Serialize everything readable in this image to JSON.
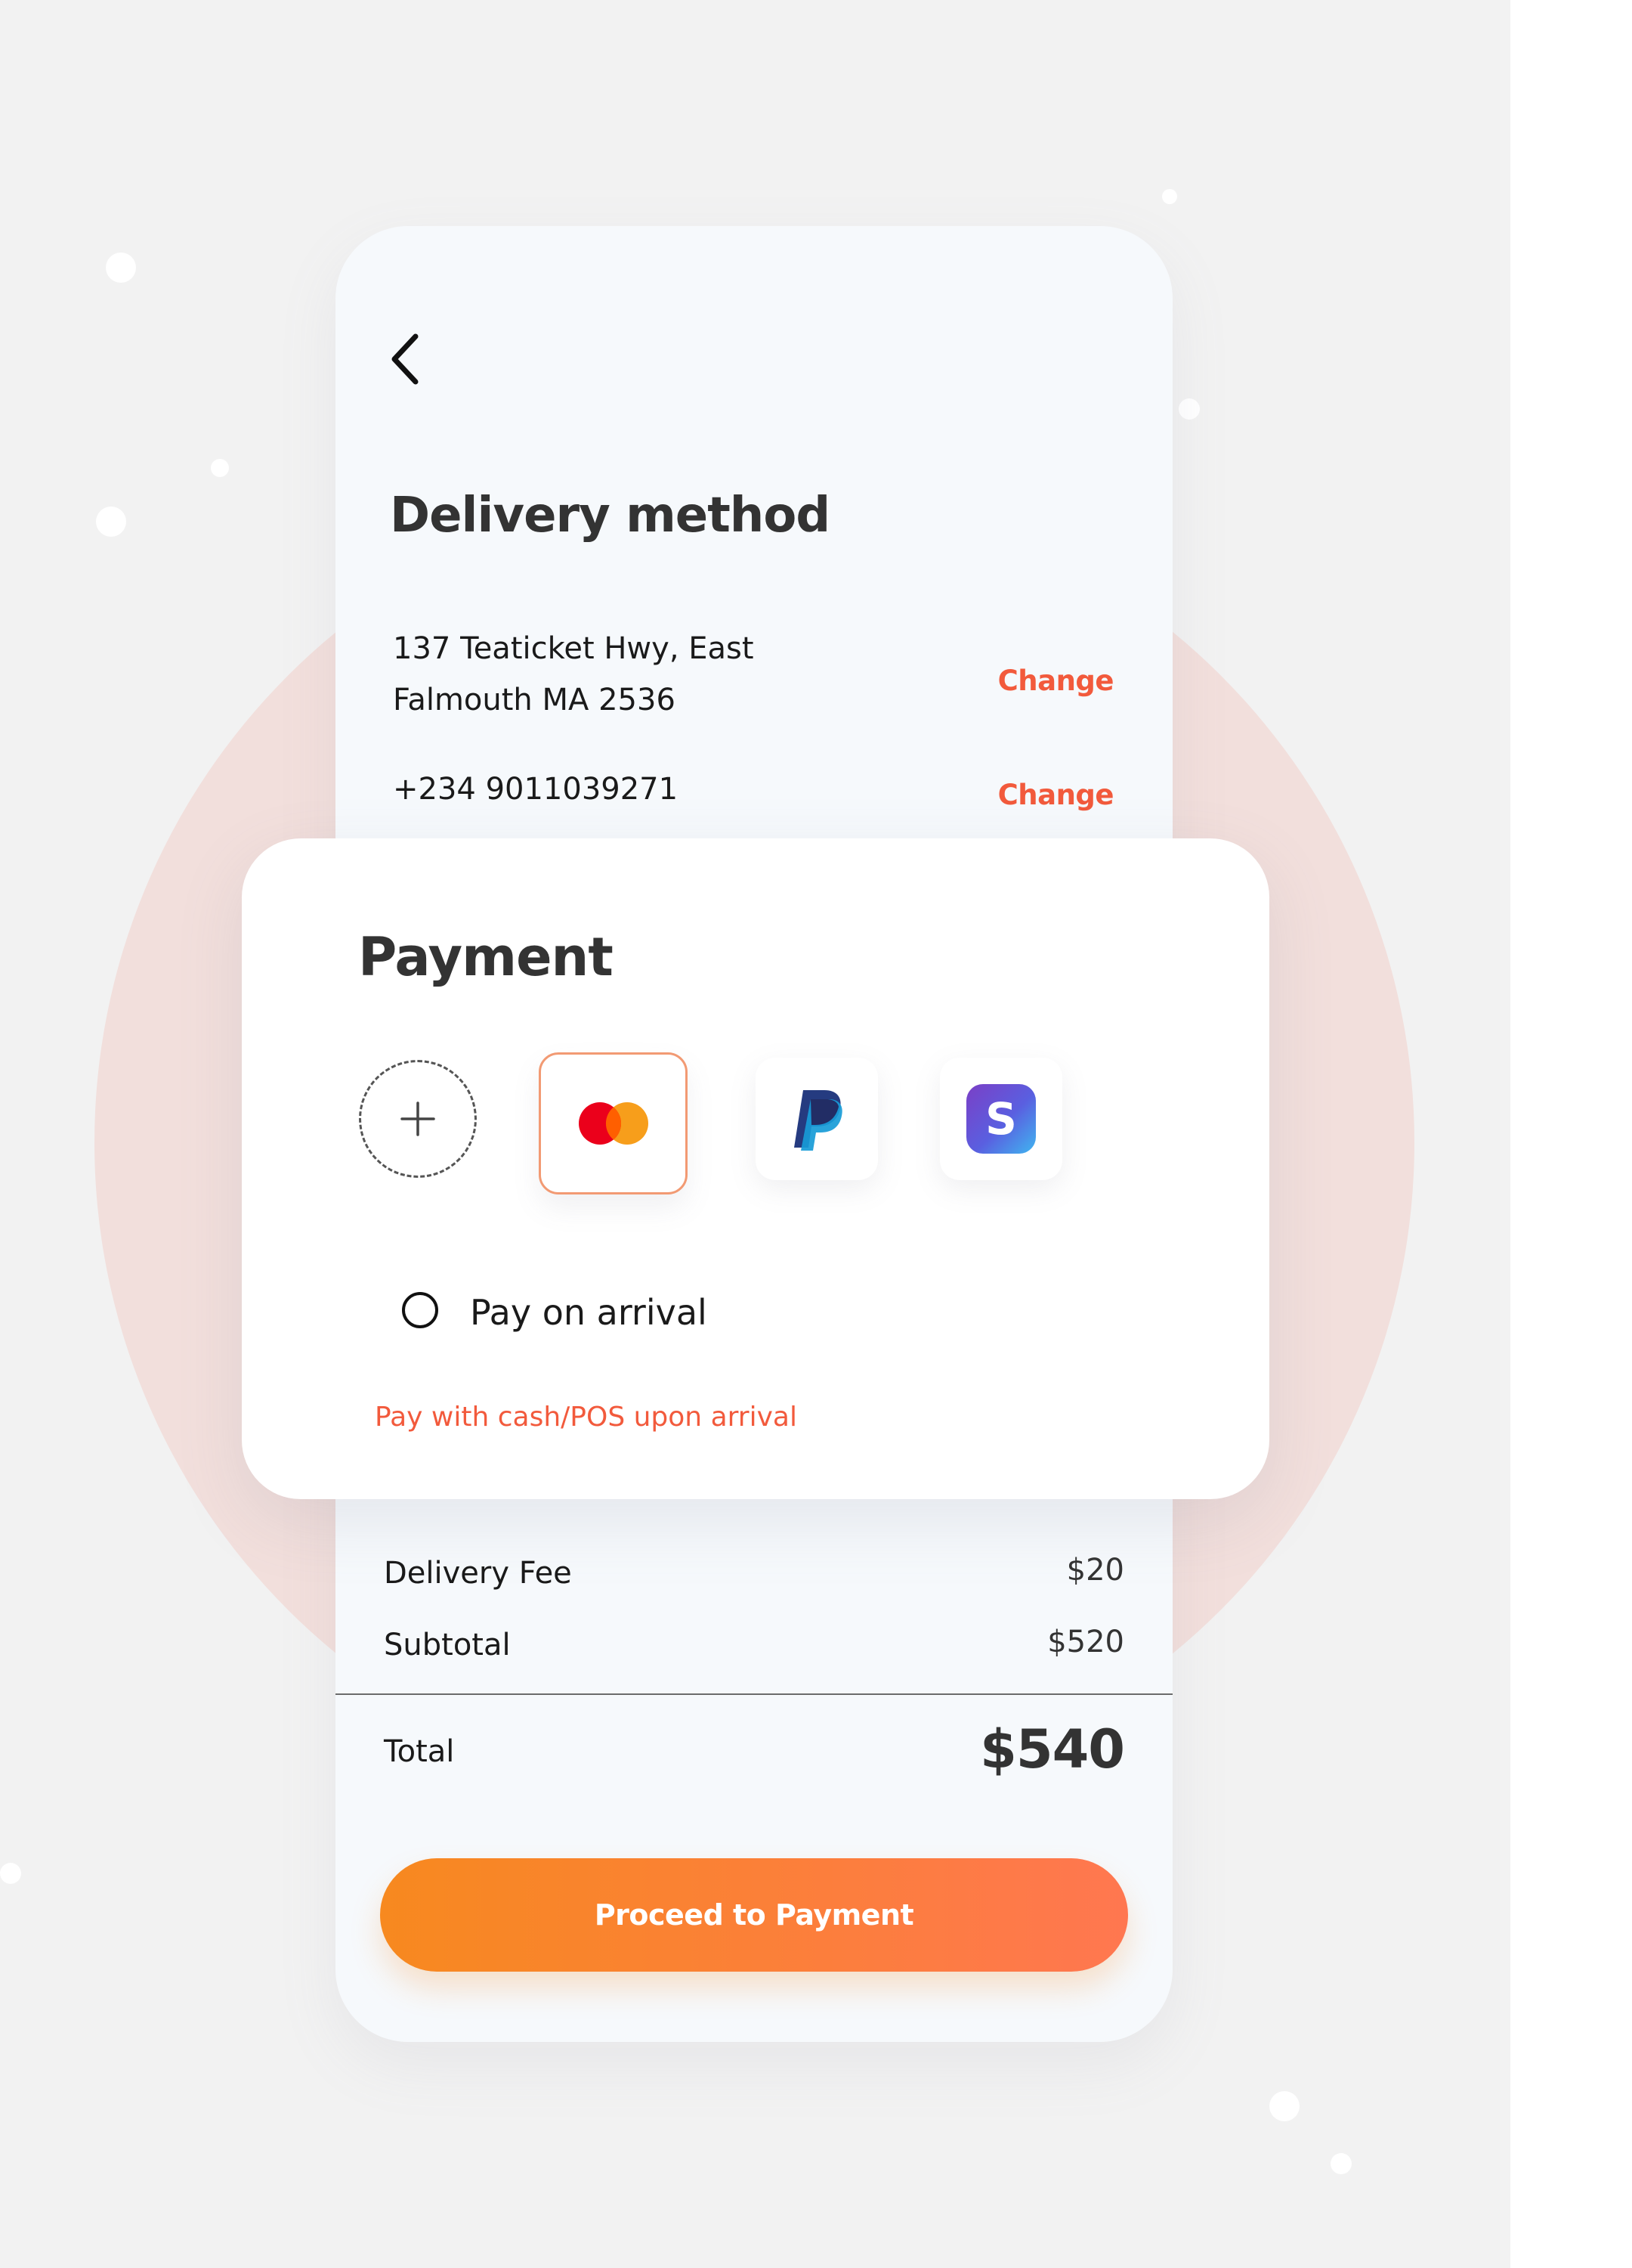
{
  "delivery": {
    "title": "Delivery method",
    "address_line_1": "137 Teaticket Hwy, East",
    "address_line_2": "Falmouth MA 2536",
    "address_change_label": "Change",
    "phone": "+234 9011039271",
    "phone_change_label": "Change"
  },
  "payment": {
    "title": "Payment",
    "methods": [
      {
        "icon": "plus-icon",
        "selected": false
      },
      {
        "icon": "mastercard-icon",
        "selected": true
      },
      {
        "icon": "paypal-icon",
        "selected": false
      },
      {
        "icon": "skrill-icon",
        "selected": false
      }
    ],
    "pay_on_arrival_label": "Pay on arrival",
    "pay_on_arrival_selected": false,
    "note": "Pay with cash/POS upon arrival"
  },
  "summary": {
    "delivery_fee_label": "Delivery Fee",
    "delivery_fee_value": "$20",
    "subtotal_label": "Subtotal",
    "subtotal_value": "$520",
    "total_label": "Total",
    "total_value": "$540"
  },
  "actions": {
    "proceed_label": "Proceed to Payment"
  },
  "colors": {
    "accent": "#f25a3c",
    "button_start": "#f7891f",
    "button_end": "#ff7750",
    "selected_border": "#f29a73",
    "background": "#f2f2f2",
    "backdrop_circle": "#f2dfdc"
  }
}
